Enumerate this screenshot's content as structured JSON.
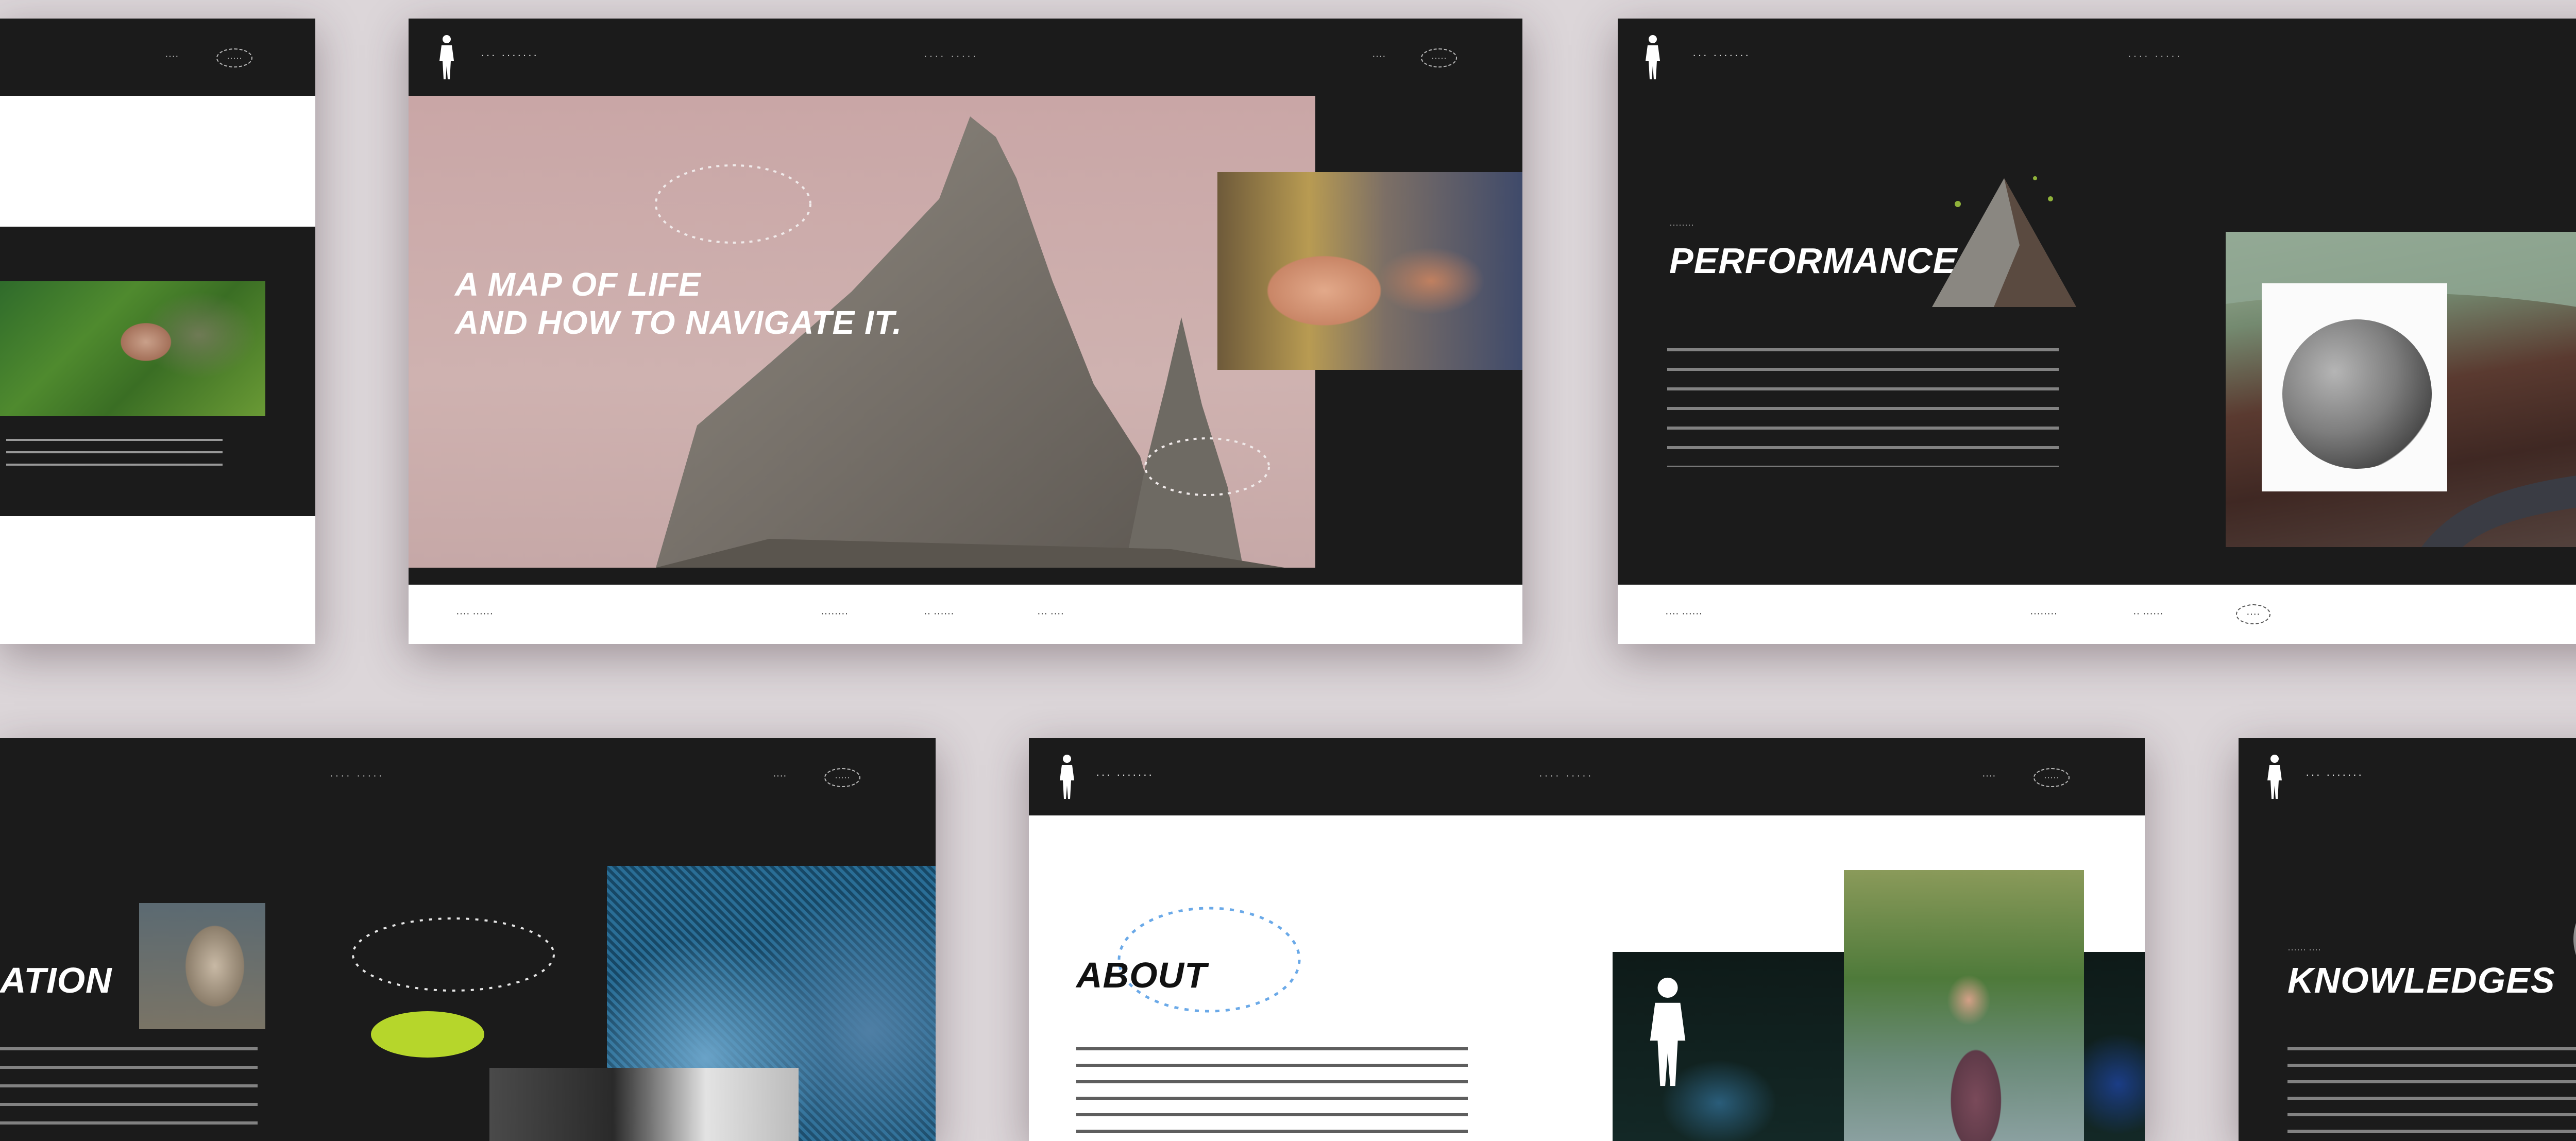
{
  "slide_main": {
    "logo": "··· ·······",
    "nav": "···· ·····",
    "header_right": "····",
    "header_circle": "·····",
    "headline_line1": "A MAP OF LIFE",
    "headline_line2": "AND HOW TO NAVIGATE IT.",
    "footer_left": "···· ······",
    "footer_links": [
      "········",
      "·· ······",
      "··· ····"
    ]
  },
  "slide_performance": {
    "small_label": "········",
    "title": "PERFORMANCE",
    "footer_left": "···· ······",
    "footer_links": [
      "········",
      "·· ······"
    ],
    "footer_circle": "····"
  },
  "slide_about": {
    "title": "ABOUT"
  },
  "slide_br": {
    "small_label": "······ ····",
    "title": "KNOWLEDGES"
  },
  "slide_bl": {
    "title": "ATION"
  },
  "colors": {
    "background": "#dcd6d9",
    "slide_dark": "#1b1b1b",
    "accent_green": "#b6d62b",
    "dashed_blue": "#6aa9e8"
  }
}
